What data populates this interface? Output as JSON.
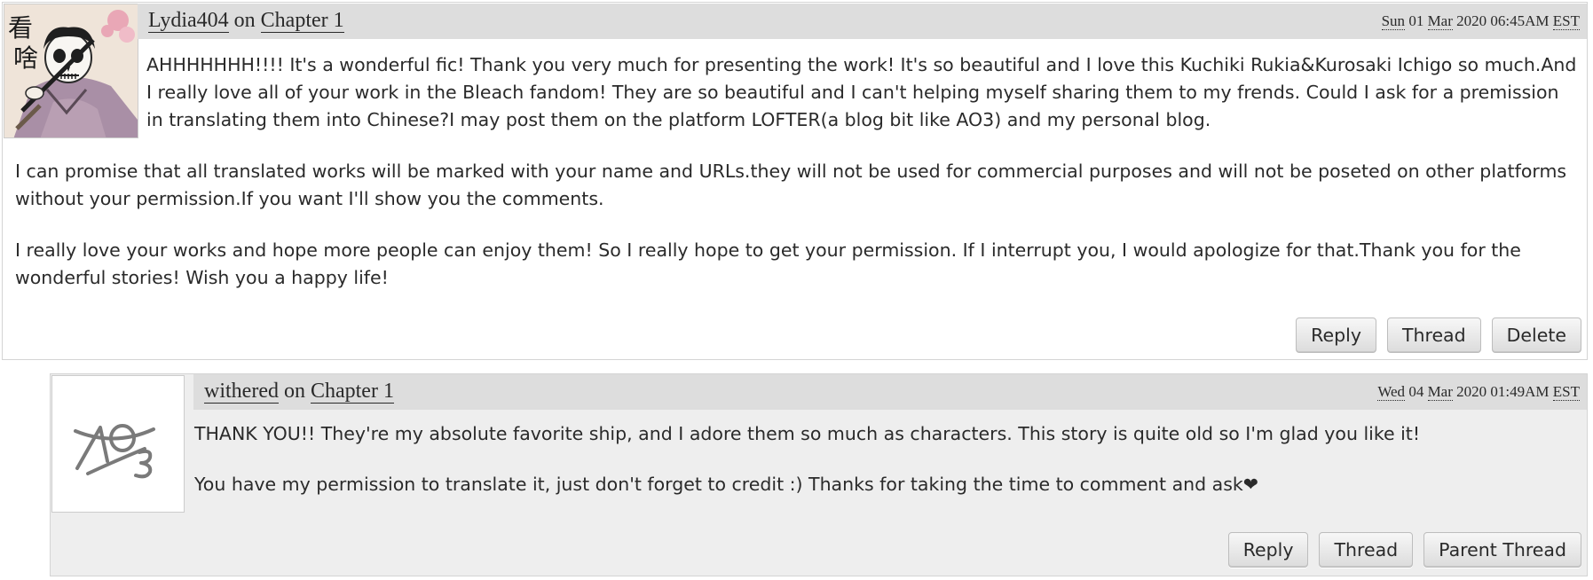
{
  "comments": [
    {
      "author": "Lydia404",
      "on_text": " on ",
      "chapter": "Chapter 1",
      "date": {
        "weekday": "Sun",
        "day": "01",
        "month": "Mar",
        "year": "2020",
        "time": "06:45AM",
        "zone": "EST"
      },
      "paragraphs": [
        "AHHHHHHH!!!! It's a wonderful fic!  Thank you very much for presenting the work! It's so beautiful and I love this Kuchiki Rukia&Kurosaki Ichigo so much.And I really love all of your work in the Bleach fandom! They are so beautiful and I can't helping myself sharing them to my frends. Could I ask for a premission in translating them into Chinese?I may post them on the platform LOFTER(a blog bit like AO3) and my personal blog.",
        "I can promise that all translated works will be marked with your name and URLs.they will not be used for commercial purposes and will not be poseted on other platforms without your permission.If you want I'll show you the comments.",
        "I really love your works and hope more people can enjoy them! So I really hope to get your permission. If I interrupt you, I would apologize for that.Thank you for the wonderful stories! Wish you a happy life!"
      ],
      "avatar_glyphs": [
        "看",
        "啥"
      ],
      "actions": [
        "Reply",
        "Thread",
        "Delete"
      ]
    },
    {
      "author": "withered",
      "on_text": " on ",
      "chapter": "Chapter 1",
      "date": {
        "weekday": "Wed",
        "day": "04",
        "month": "Mar",
        "year": "2020",
        "time": "01:49AM",
        "zone": "EST"
      },
      "paragraphs": [
        "THANK YOU!! They're my absolute favorite ship, and I adore them so much as characters. This story is quite old so I'm glad you like it!",
        "You have my permission to translate it, just don't forget to credit :) Thanks for taking the time to comment and ask❤"
      ],
      "actions": [
        "Reply",
        "Thread",
        "Parent Thread"
      ]
    }
  ],
  "colors": {
    "header_bg": "#dddddd",
    "reply_bg": "#eeeeee",
    "text": "#2a2a2a",
    "border": "#d4d4d4"
  }
}
